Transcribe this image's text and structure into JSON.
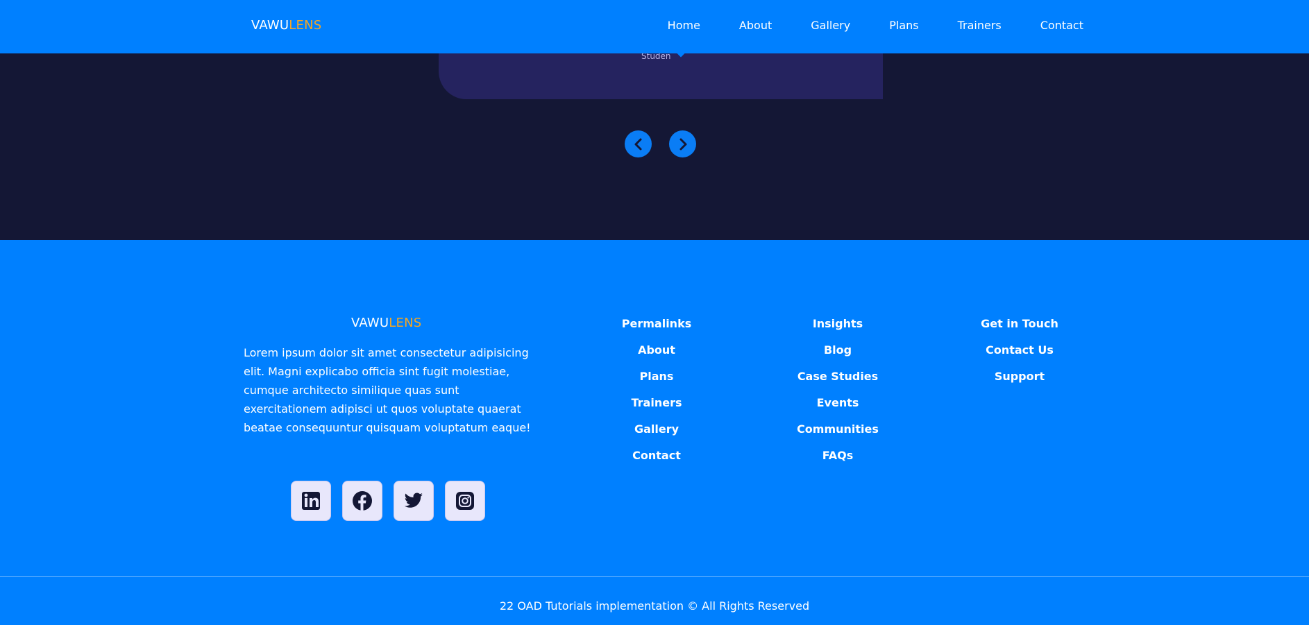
{
  "brand": {
    "part1": "VAWU",
    "part2": "LENS"
  },
  "nav": {
    "links": [
      "Home",
      "About",
      "Gallery",
      "Plans",
      "Trainers",
      "Contact"
    ]
  },
  "testimonial": {
    "role_label": "Studen"
  },
  "footer": {
    "description": "Lorem ipsum dolor sit amet consectetur adipisicing elit. Magni explicabo officia sint fugit molestiae, cumque architecto similique quas sunt exercitationem adipisci ut quos voluptate quaerat beatae consequuntur quisquam voluptatum eaque!",
    "socials": [
      "linkedin-icon",
      "facebook-icon",
      "twitter-icon",
      "instagram-icon"
    ],
    "columns": [
      {
        "title": "Permalinks",
        "links": [
          "About",
          "Plans",
          "Trainers",
          "Gallery",
          "Contact"
        ]
      },
      {
        "title": "Insights",
        "links": [
          "Blog",
          "Case Studies",
          "Events",
          "Communities",
          "FAQs"
        ]
      },
      {
        "title": "Get in Touch",
        "links": [
          "Contact Us",
          "Support"
        ]
      }
    ],
    "copyright": "22 OAD Tutorials implementation © All Rights Reserved"
  },
  "colors": {
    "primary": "#0080ff",
    "accent": "#f5a623",
    "dark_bg": "#141735",
    "card_bg": "#25235f"
  }
}
